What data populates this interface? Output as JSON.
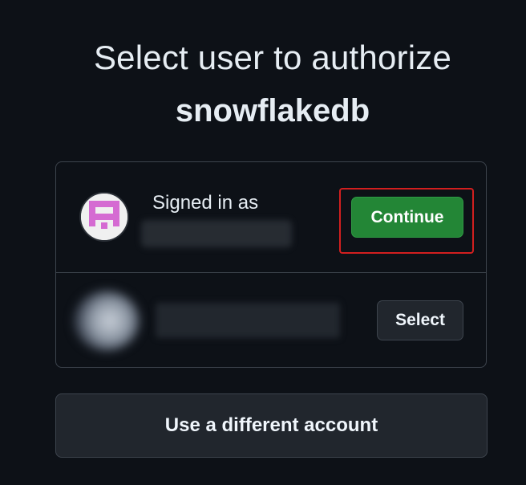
{
  "header": {
    "title": "Select user to authorize",
    "app_name": "snowflakedb"
  },
  "accounts": {
    "current": {
      "signed_in_label": "Signed in as",
      "continue_label": "Continue",
      "avatar_icon": "identicon-avatar-icon",
      "avatar_color": "#d56bd2"
    },
    "other": {
      "select_label": "Select",
      "avatar_icon": "blurred-avatar-icon"
    }
  },
  "footer": {
    "different_account_label": "Use a different account"
  },
  "colors": {
    "background": "#0d1117",
    "primary_button": "#238636",
    "highlight": "#d21f1f",
    "border": "#3d444d"
  }
}
